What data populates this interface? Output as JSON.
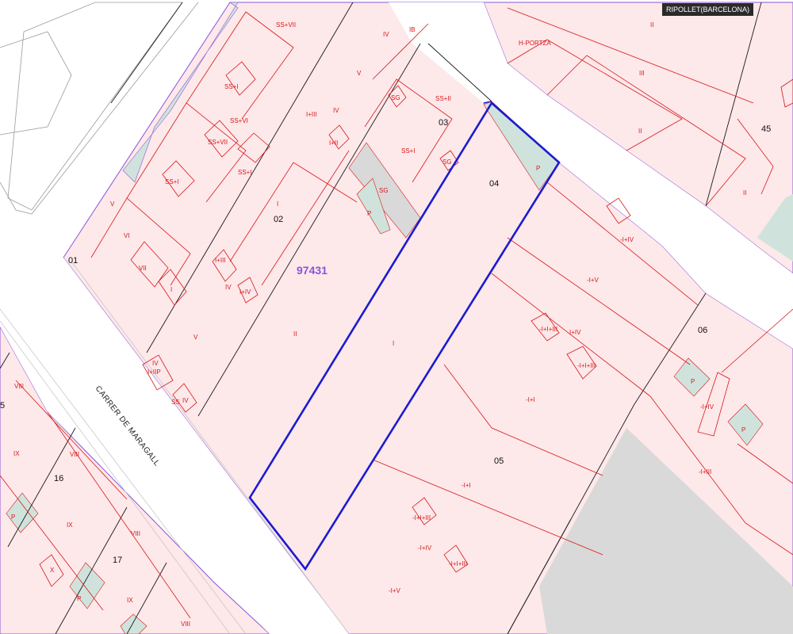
{
  "location": "RIPOLLET(BARCELONA)",
  "street": {
    "name": "CARRER DE MARAGALL"
  },
  "parcel_ref": "97431",
  "colors": {
    "road": "#ffffff",
    "parcel_fill": "#fde8ea",
    "building_line": "#d81818",
    "block_border": "#8a55d6",
    "selection": "#1b1bcf",
    "courtyard": "#cfe3dc",
    "gray_fill": "#d9d9d9"
  },
  "parcel_numbers": {
    "p01": "01",
    "p02": "02",
    "p03": "03",
    "p04": "04",
    "p05": "05",
    "p06": "06",
    "p45": "45",
    "p16": "16",
    "p17": "17",
    "p5": "5"
  },
  "floor_labels": {
    "ssvii_a": "SS+VII",
    "iv_a": "IV",
    "ib": "IB",
    "hportza": "H-PORTZA",
    "ii_a": "II",
    "iii_a": "III",
    "v_a": "V",
    "ssi_a": "SS+I",
    "ssvi": "SS+VI",
    "iiii_a": "I+III",
    "iv_b": "IV",
    "sg_a": "SG",
    "ssii": "SS+II",
    "ii_b": "II",
    "ssvii_b": "SS+VII",
    "ii_c": "I+II",
    "ssi_b": "SS+I",
    "ssi_c": "SS+I",
    "ssi_d": "SS+I",
    "sg_b": "SG",
    "sg_c": "SG",
    "ii_d": "II",
    "i_a": "I",
    "p_a": "P",
    "p_b": "P",
    "v_b": "V",
    "vi": "VI",
    "vii": "VII",
    "i_b": "I",
    "iiii_b": "I+III",
    "iv_c": "IV",
    "iiv_a": "I+IV",
    "ii_e": "II",
    "i_c": "I",
    "iiv_b": "-I+IV",
    "iiv_c": "I+IV",
    "iv_d": "-I+V",
    "v_c": "V",
    "iv_e": "IV",
    "iv_f": "IV",
    "iip": "I+IIP",
    "ss": "SS",
    "iiiii": "-I+I+III",
    "iiv_d": "-I+IV",
    "iiiii_b": "-I+I+III",
    "ii_f": "-I+I",
    "p_c": "P",
    "iiv_e": "-I+IV",
    "p_d": "P",
    "iiii_c": "-I+III",
    "viii": "VIII",
    "ix_a": "IX",
    "viii_b": "VIII",
    "ix_b": "IX",
    "p_e": "P",
    "x": "X",
    "p_f": "P",
    "viii_c": "VIII",
    "ix_c": "IX",
    "viii_d": "VIII",
    "ii_g": "-I+I",
    "iiii_d": "-I+I+III",
    "iiv_f": "-I+IV",
    "iiiii_c": "-I+I+III",
    "iv_g": "-I+V"
  }
}
